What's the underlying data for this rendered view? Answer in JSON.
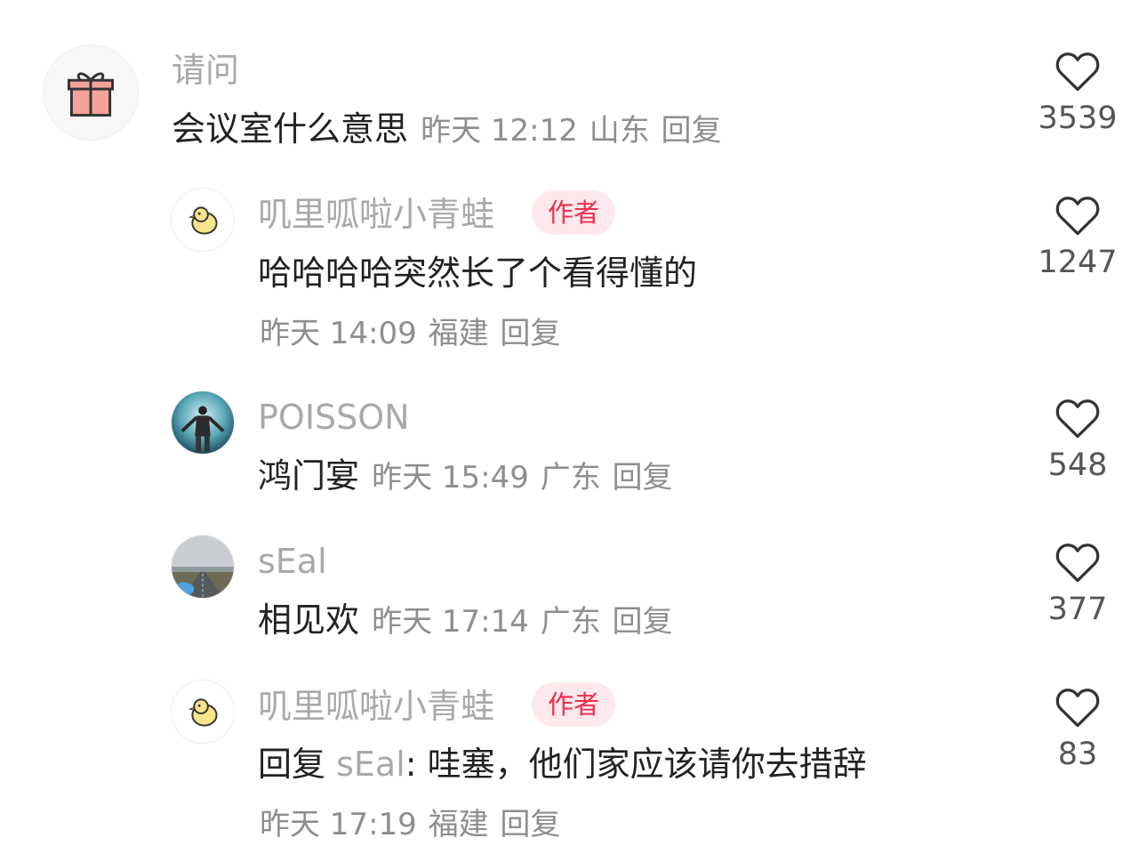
{
  "comments": [
    {
      "username": "请问",
      "text": "会议室什么意思",
      "time": "昨天 12:12",
      "location": "山东",
      "reply_label": "回复",
      "likes": "3539",
      "avatar_icon": "gift-icon"
    },
    {
      "username": "叽里呱啦小青蛙",
      "badge": "作者",
      "text": "哈哈哈哈突然长了个看得懂的",
      "time": "昨天 14:09",
      "location": "福建",
      "reply_label": "回复",
      "likes": "1247",
      "avatar_icon": "chick-icon"
    },
    {
      "username": "POISSON",
      "text": "鸿门宴",
      "time": "昨天 15:49",
      "location": "广东",
      "reply_label": "回复",
      "likes": "548",
      "avatar_icon": "person-photo"
    },
    {
      "username": "sEal",
      "text": "相见欢",
      "time": "昨天 17:14",
      "location": "广东",
      "reply_label": "回复",
      "likes": "377",
      "avatar_icon": "road-photo"
    },
    {
      "username": "叽里呱啦小青蛙",
      "badge": "作者",
      "reply_prefix": "回复",
      "mention": "sEal",
      "text": ": 哇塞，他们家应该请你去措辞",
      "time": "昨天 17:19",
      "location": "福建",
      "reply_label": "回复",
      "likes": "83",
      "avatar_icon": "chick-icon"
    }
  ],
  "colors": {
    "username": "#a9a9a9",
    "text": "#222222",
    "meta": "#8e8e8e",
    "badge_bg": "#fde9ec",
    "badge_text": "#ee2c50"
  }
}
